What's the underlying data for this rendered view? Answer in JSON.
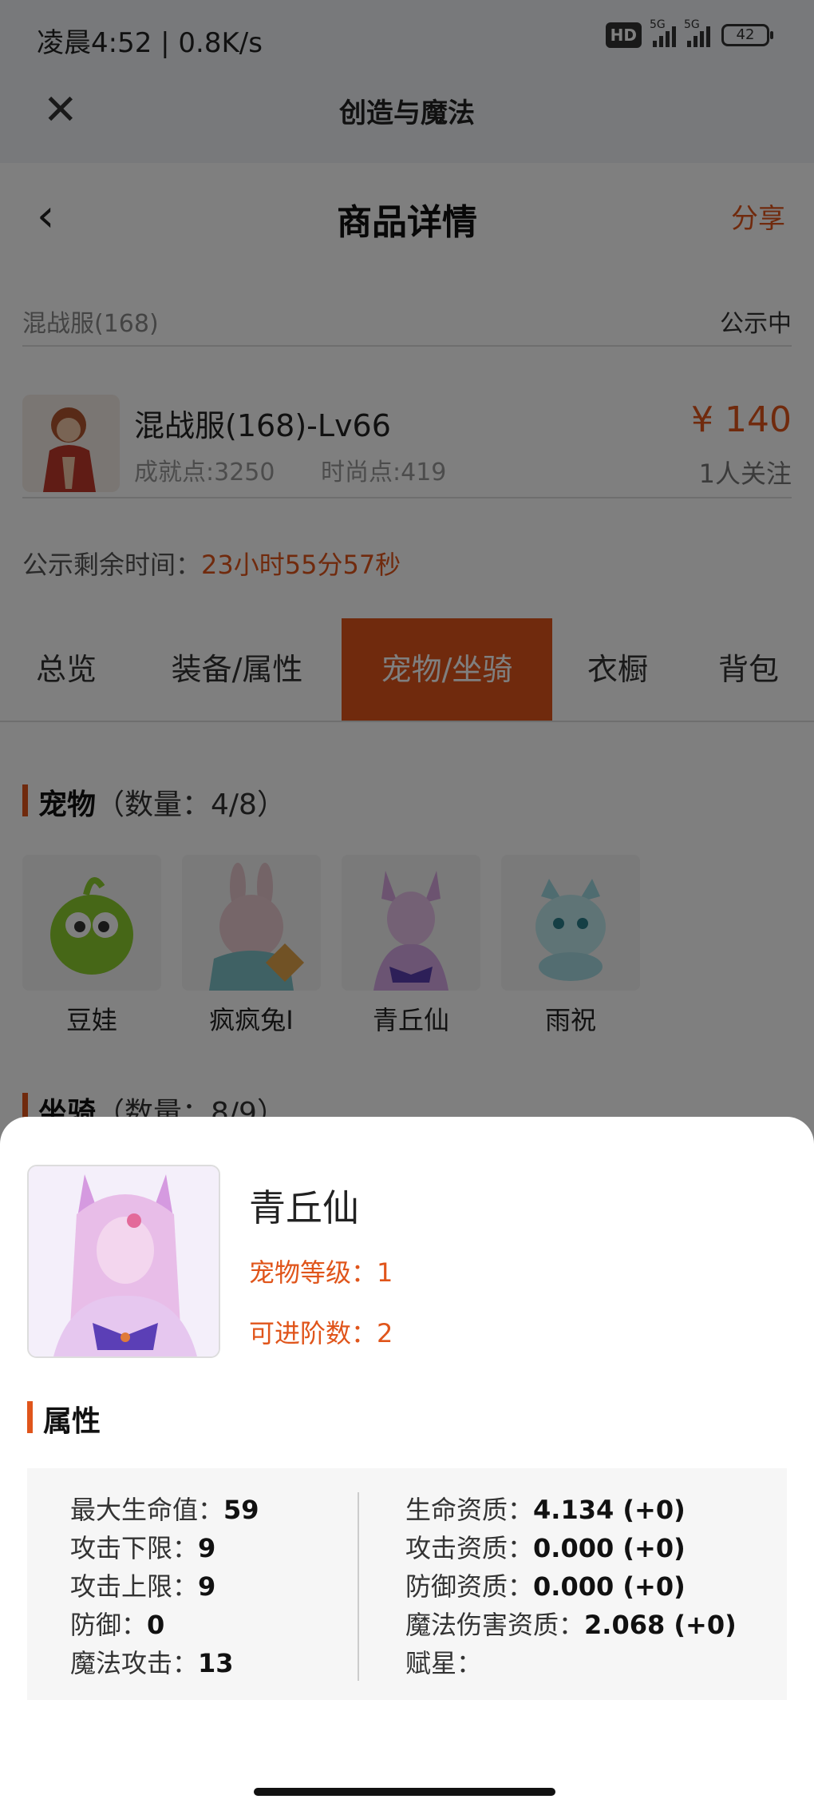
{
  "status": {
    "time": "凌晨4:52 | 0.8K/s",
    "hd": "HD",
    "net1": "5G",
    "net2": "5G",
    "battery": "42"
  },
  "window": {
    "title": "创造与魔法"
  },
  "detail": {
    "nav_title": "商品详情",
    "share": "分享",
    "server": "混战服(168)",
    "status": "公示中",
    "item_title": "混战服(168)-Lv66",
    "achievement": "成就点:3250",
    "fashion": "时尚点:419",
    "price": "¥ 140",
    "followers": "1人关注",
    "countdown_label": "公示剩余时间：",
    "countdown_value": "23小时55分57秒"
  },
  "tabs": [
    {
      "label": "总览"
    },
    {
      "label": "装备/属性"
    },
    {
      "label": "宠物/坐骑",
      "active": true
    },
    {
      "label": "衣橱"
    },
    {
      "label": "背包"
    }
  ],
  "pets_section": {
    "title": "宠物",
    "count": "（数量：4/8）"
  },
  "pets": [
    {
      "name": "豆娃"
    },
    {
      "name": "疯疯兔I"
    },
    {
      "name": "青丘仙"
    },
    {
      "name": "雨祝"
    }
  ],
  "mounts_section": {
    "title": "坐骑",
    "count": "（数量：8/9）"
  },
  "sheet": {
    "name": "青丘仙",
    "level": "宠物等级：1",
    "advance": "可进阶数：2",
    "attr_title": "属性",
    "left": [
      {
        "label": "最大生命值：",
        "value": "59"
      },
      {
        "label": "攻击下限：",
        "value": "9"
      },
      {
        "label": "攻击上限：",
        "value": "9"
      },
      {
        "label": "防御：",
        "value": "0"
      },
      {
        "label": "魔法攻击：",
        "value": "13"
      }
    ],
    "right": [
      {
        "label": "生命资质：",
        "value": "4.134 (+0)"
      },
      {
        "label": "攻击资质：",
        "value": "0.000 (+0)"
      },
      {
        "label": "防御资质：",
        "value": "0.000 (+0)"
      },
      {
        "label": "魔法伤害资质：",
        "value": "2.068 (+0)"
      },
      {
        "label": "赋星：",
        "value": ""
      }
    ]
  },
  "colors": {
    "accent": "#e0551b",
    "overlay": "rgba(0,0,0,0.5)"
  }
}
